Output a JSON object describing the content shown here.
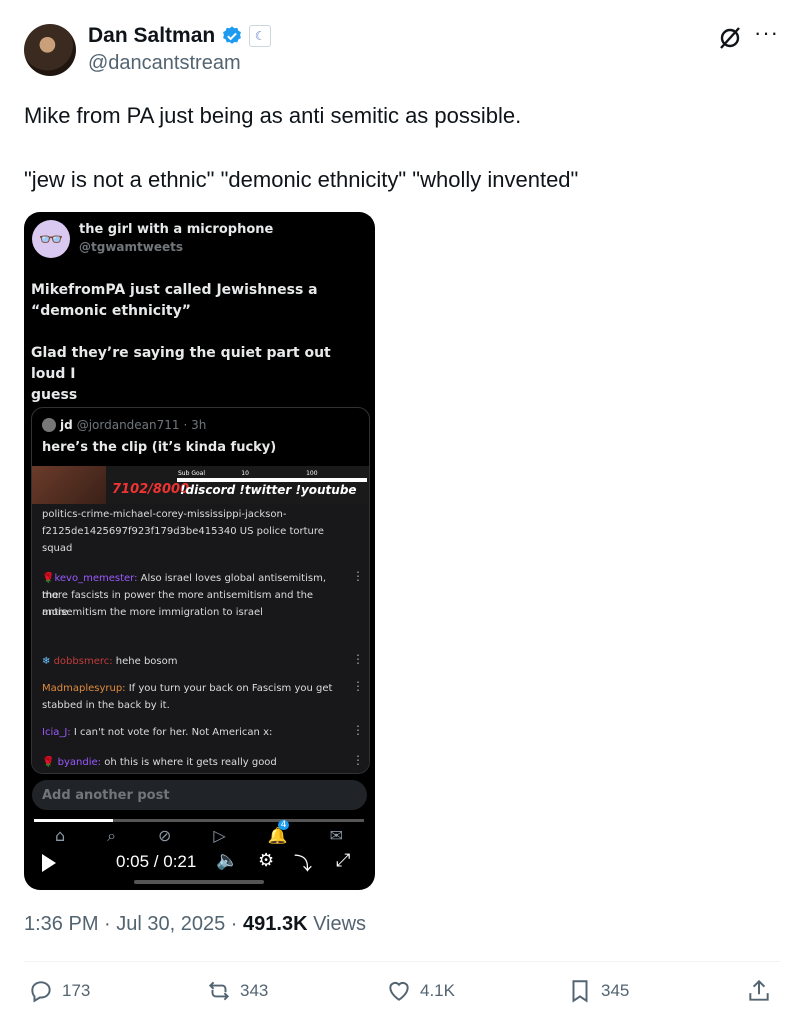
{
  "author": {
    "name": "Dan Saltman",
    "handle": "@dancantstream"
  },
  "tweet": {
    "line1": "Mike from PA just being as anti semitic as possible.",
    "line2": "\"jew is not a ethnic\" \"demonic ethnicity\" \"wholly invented\""
  },
  "media": {
    "quoted_author": {
      "name": "the girl with a microphone",
      "handle": "@tgwamtweets"
    },
    "quoted_text1": "MikefromPA just called Jewishness a\n“demonic ethnicity”",
    "quoted_text2": "Glad they’re saying the quiet part out loud I\nguess",
    "inner": {
      "name": "jd",
      "handle": "@jordandean711",
      "time": "· 3h",
      "text": "here’s the clip (it’s kinda fucky)"
    },
    "stream": {
      "subs": "7102/8000",
      "commands": "!discord !twitter !youtube",
      "goal_label": "Sub Goal",
      "goal_mid": "10",
      "goal_max": "100"
    },
    "chat": [
      {
        "user": "",
        "text": "politics-crime-michael-corey-mississippi-jackson-"
      },
      {
        "user": "",
        "text": "f2125de1425697f923f179d3be415340 US police torture"
      },
      {
        "user": "",
        "text": "squad"
      },
      {
        "user": "kevo_memester:",
        "text": " Also israel loves global antisemitism, the"
      },
      {
        "user": "",
        "text": "more fascists in power the more antisemitism and the more"
      },
      {
        "user": "",
        "text": "antisemitism the more immigration to israel"
      },
      {
        "user": "dobbsmerc:",
        "text": " hehe bosom"
      },
      {
        "user": "Madmaplesyrup:",
        "text": " If you turn your back on Fascism you get"
      },
      {
        "user": "",
        "text": "stabbed in the back by it."
      },
      {
        "user": "Icia_J:",
        "text": " I can't not vote for her. Not American x:"
      },
      {
        "user": "byandie:",
        "text": " oh this is where it gets really good"
      }
    ],
    "add_post_placeholder": "Add another post",
    "notification_count": "4",
    "player": {
      "time": "0:05 / 0:21",
      "progress": 0.24
    }
  },
  "meta": {
    "time": "1:36 PM · Jul 30, 2025 · ",
    "views_count": "491.3K",
    "views_label": " Views"
  },
  "actions": {
    "replies": "173",
    "reposts": "343",
    "likes": "4.1K",
    "bookmarks": "345"
  },
  "colors": {
    "accent": "#1d9bf0",
    "muted": "#536471",
    "media_bg": "#000000"
  }
}
